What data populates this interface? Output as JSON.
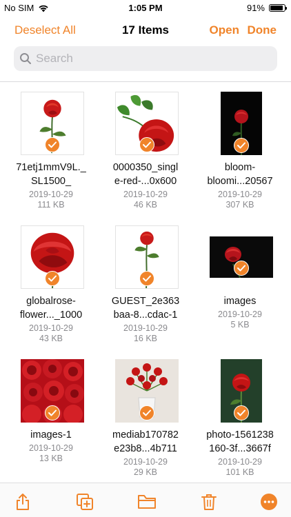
{
  "status": {
    "carrier": "No SIM",
    "time": "1:05 PM",
    "battery": "91%",
    "battery_level": 0.91
  },
  "nav": {
    "deselect_label": "Deselect All",
    "title": "17 Items",
    "open_label": "Open",
    "done_label": "Done"
  },
  "search": {
    "placeholder": "Search"
  },
  "items": [
    {
      "name_lines": [
        "71etj1mmV9L._",
        "SL1500_"
      ],
      "date": "2019-10-29",
      "size": "111 KB",
      "selected": true
    },
    {
      "name_lines": [
        "0000350_singl",
        "e-red-...0x600"
      ],
      "date": "2019-10-29",
      "size": "46 KB",
      "selected": true
    },
    {
      "name_lines": [
        "bloom-",
        "bloomi...20567"
      ],
      "date": "2019-10-29",
      "size": "307 KB",
      "selected": true
    },
    {
      "name_lines": [
        "globalrose-",
        "flower..._1000"
      ],
      "date": "2019-10-29",
      "size": "43 KB",
      "selected": true
    },
    {
      "name_lines": [
        "GUEST_2e363",
        "baa-8...cdac-1"
      ],
      "date": "2019-10-29",
      "size": "16 KB",
      "selected": true
    },
    {
      "name_lines": [
        "images"
      ],
      "date": "2019-10-29",
      "size": "5 KB",
      "selected": true
    },
    {
      "name_lines": [
        "images-1"
      ],
      "date": "2019-10-29",
      "size": "13 KB",
      "selected": true
    },
    {
      "name_lines": [
        "mediab170782",
        "e23b8...4b711"
      ],
      "date": "2019-10-29",
      "size": "29 KB",
      "selected": true
    },
    {
      "name_lines": [
        "photo-1561238",
        "160-3f...3667f"
      ],
      "date": "2019-10-29",
      "size": "101 KB",
      "selected": true
    }
  ],
  "toolbar": {
    "icons": [
      "share-icon",
      "duplicate-icon",
      "folder-icon",
      "trash-icon",
      "more-icon"
    ]
  },
  "colors": {
    "accent": "#f0842a"
  }
}
